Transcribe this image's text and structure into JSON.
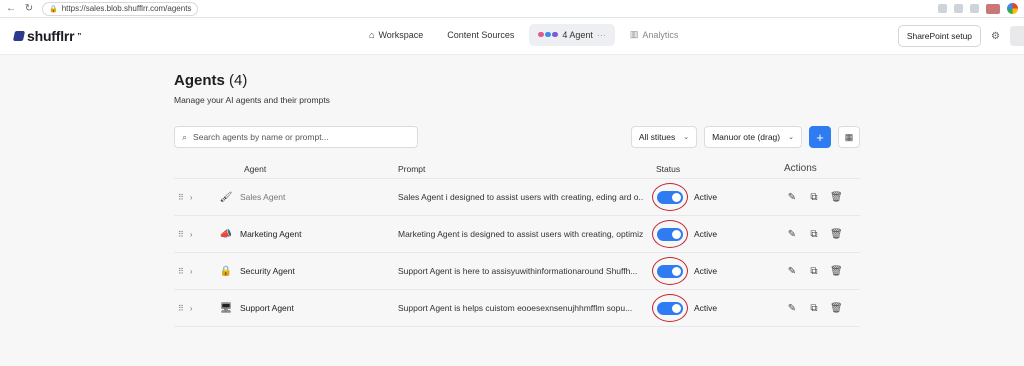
{
  "browser": {
    "url": "https://sales.blob.shufflrr.com/agents"
  },
  "brand": {
    "name": "shufflrr"
  },
  "nav": {
    "workspace": "Workspace",
    "content_sources": "Content Sources",
    "agents_tab": "4 Agent",
    "analytics": "Analytics"
  },
  "header": {
    "sharepoint_setup": "SharePoint setup"
  },
  "page": {
    "title": "Agents",
    "count": "(4)",
    "subtitle": "Manage your AI agents and their prompts"
  },
  "toolbar": {
    "search_placeholder": "Search agents by name or prompt...",
    "status_filter": "All stitues",
    "order_select": "Manuor ote (drag)",
    "add_label": "+"
  },
  "table": {
    "headers": {
      "agent": "Agent",
      "prompt": "Prompt",
      "status": "Status",
      "actions": "Actions"
    },
    "rows": [
      {
        "name": "Sales Agent",
        "icon": "🖌",
        "prompt": "Sales Agent i designed to assist users with creating, eding ard o...",
        "status": "Active"
      },
      {
        "name": "Marketing Agent",
        "icon": "📣",
        "prompt": "Marketing Agent is designed to assist users with creating, optimiz...",
        "status": "Active"
      },
      {
        "name": "Security Agent",
        "icon": "🔒",
        "prompt": "Support Agent is here to assisyuwithinformationaround Shuffh...",
        "status": "Active"
      },
      {
        "name": "Support Agent",
        "icon": "🖥",
        "prompt": "Support Agent is helps cuistom eooesexnsenujhhmfflm sopu...",
        "status": "Active"
      }
    ]
  },
  "colors": {
    "accent": "#2f7bf2",
    "highlight_ring": "#c4242c"
  }
}
